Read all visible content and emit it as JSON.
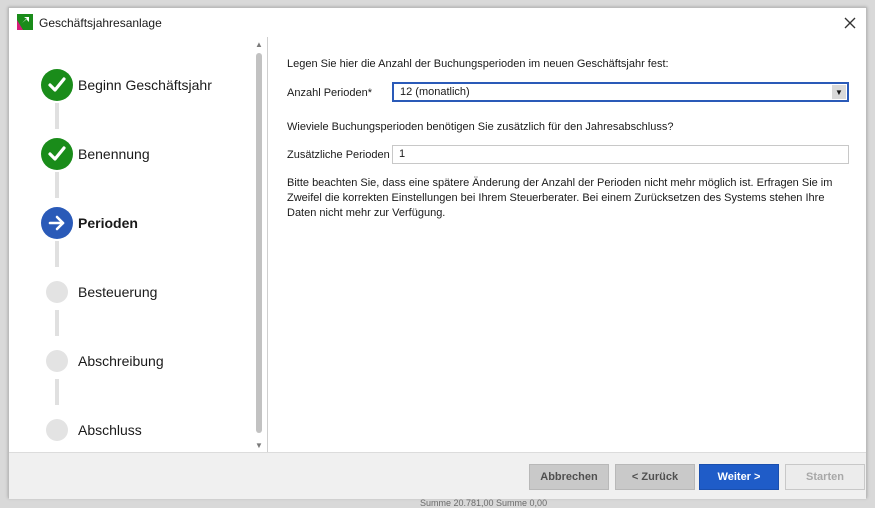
{
  "window": {
    "title": "Geschäftsjahresanlage"
  },
  "steps": [
    {
      "label": "Beginn Geschäftsjahr",
      "state": "done"
    },
    {
      "label": "Benennung",
      "state": "done"
    },
    {
      "label": "Perioden",
      "state": "current"
    },
    {
      "label": "Besteuerung",
      "state": "pending"
    },
    {
      "label": "Abschreibung",
      "state": "pending"
    },
    {
      "label": "Abschluss",
      "state": "pending"
    }
  ],
  "form": {
    "intro": "Legen Sie hier die Anzahl der Buchungsperioden im neuen Geschäftsjahr fest:",
    "periods_label": "Anzahl Perioden*",
    "periods_value": "12 (monatlich)",
    "question": "Wieviele Buchungsperioden benötigen Sie zusätzlich für den Jahresabschluss?",
    "extra_label": "Zusätzliche Perioden",
    "extra_value": "1",
    "notice": "Bitte beachten Sie, dass eine spätere Änderung der Anzahl der Perioden nicht mehr möglich ist. Erfragen Sie im Zweifel die korrekten Einstellungen bei Ihrem Steuerberater. Bei einem Zurücksetzen des Systems stehen Ihre Daten nicht mehr zur Verfügung."
  },
  "buttons": {
    "cancel": "Abbrechen",
    "back": "< Zurück",
    "next": "Weiter >",
    "start": "Starten"
  },
  "background": {
    "text": "Summe    20.781,00            Summe    0,00"
  },
  "colors": {
    "accent": "#1f5cc8",
    "done": "#1a8c1a",
    "current": "#2a5ab8",
    "pending": "#e3e3e3"
  }
}
